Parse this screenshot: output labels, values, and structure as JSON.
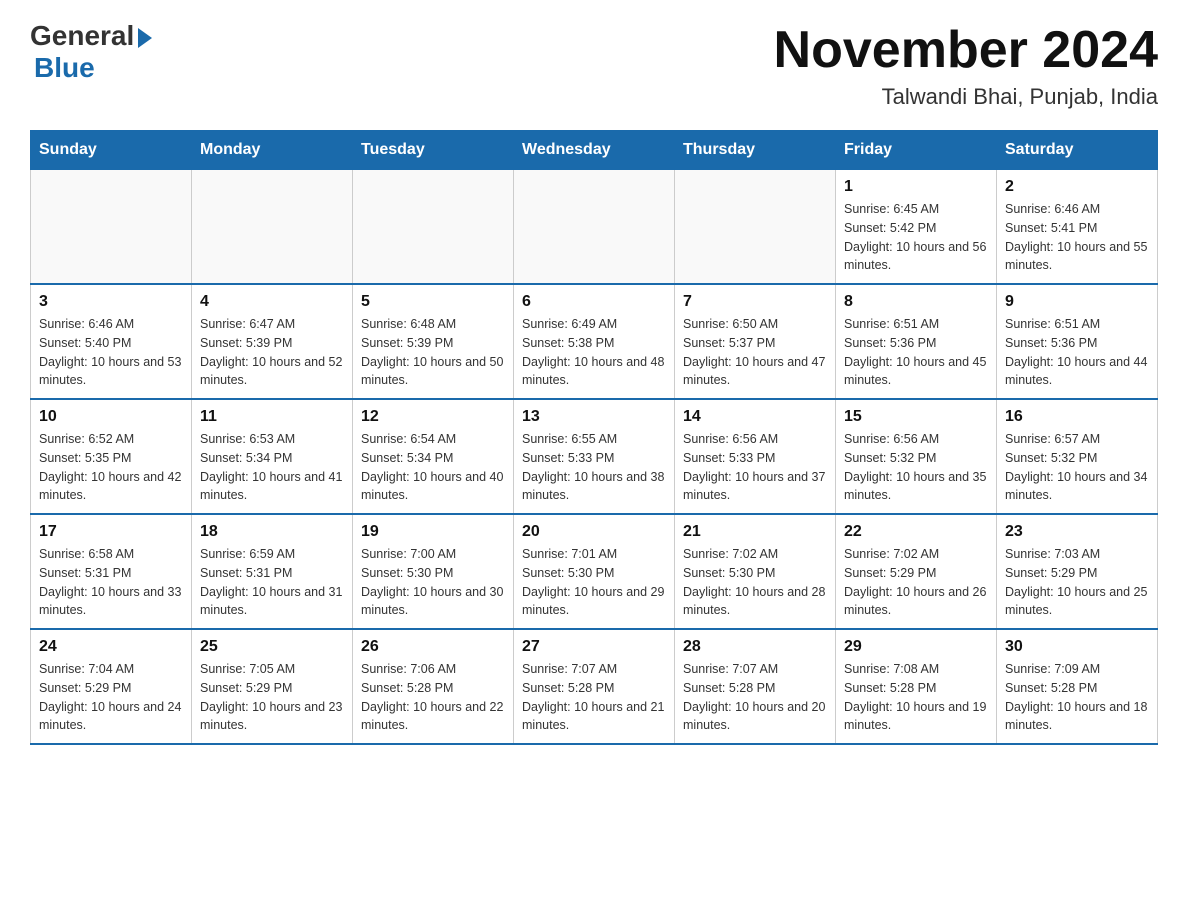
{
  "header": {
    "logo_general": "General",
    "logo_blue": "Blue",
    "month_year": "November 2024",
    "location": "Talwandi Bhai, Punjab, India"
  },
  "days_of_week": [
    "Sunday",
    "Monday",
    "Tuesday",
    "Wednesday",
    "Thursday",
    "Friday",
    "Saturday"
  ],
  "weeks": [
    [
      {
        "day": "",
        "sunrise": "",
        "sunset": "",
        "daylight": ""
      },
      {
        "day": "",
        "sunrise": "",
        "sunset": "",
        "daylight": ""
      },
      {
        "day": "",
        "sunrise": "",
        "sunset": "",
        "daylight": ""
      },
      {
        "day": "",
        "sunrise": "",
        "sunset": "",
        "daylight": ""
      },
      {
        "day": "",
        "sunrise": "",
        "sunset": "",
        "daylight": ""
      },
      {
        "day": "1",
        "sunrise": "Sunrise: 6:45 AM",
        "sunset": "Sunset: 5:42 PM",
        "daylight": "Daylight: 10 hours and 56 minutes."
      },
      {
        "day": "2",
        "sunrise": "Sunrise: 6:46 AM",
        "sunset": "Sunset: 5:41 PM",
        "daylight": "Daylight: 10 hours and 55 minutes."
      }
    ],
    [
      {
        "day": "3",
        "sunrise": "Sunrise: 6:46 AM",
        "sunset": "Sunset: 5:40 PM",
        "daylight": "Daylight: 10 hours and 53 minutes."
      },
      {
        "day": "4",
        "sunrise": "Sunrise: 6:47 AM",
        "sunset": "Sunset: 5:39 PM",
        "daylight": "Daylight: 10 hours and 52 minutes."
      },
      {
        "day": "5",
        "sunrise": "Sunrise: 6:48 AM",
        "sunset": "Sunset: 5:39 PM",
        "daylight": "Daylight: 10 hours and 50 minutes."
      },
      {
        "day": "6",
        "sunrise": "Sunrise: 6:49 AM",
        "sunset": "Sunset: 5:38 PM",
        "daylight": "Daylight: 10 hours and 48 minutes."
      },
      {
        "day": "7",
        "sunrise": "Sunrise: 6:50 AM",
        "sunset": "Sunset: 5:37 PM",
        "daylight": "Daylight: 10 hours and 47 minutes."
      },
      {
        "day": "8",
        "sunrise": "Sunrise: 6:51 AM",
        "sunset": "Sunset: 5:36 PM",
        "daylight": "Daylight: 10 hours and 45 minutes."
      },
      {
        "day": "9",
        "sunrise": "Sunrise: 6:51 AM",
        "sunset": "Sunset: 5:36 PM",
        "daylight": "Daylight: 10 hours and 44 minutes."
      }
    ],
    [
      {
        "day": "10",
        "sunrise": "Sunrise: 6:52 AM",
        "sunset": "Sunset: 5:35 PM",
        "daylight": "Daylight: 10 hours and 42 minutes."
      },
      {
        "day": "11",
        "sunrise": "Sunrise: 6:53 AM",
        "sunset": "Sunset: 5:34 PM",
        "daylight": "Daylight: 10 hours and 41 minutes."
      },
      {
        "day": "12",
        "sunrise": "Sunrise: 6:54 AM",
        "sunset": "Sunset: 5:34 PM",
        "daylight": "Daylight: 10 hours and 40 minutes."
      },
      {
        "day": "13",
        "sunrise": "Sunrise: 6:55 AM",
        "sunset": "Sunset: 5:33 PM",
        "daylight": "Daylight: 10 hours and 38 minutes."
      },
      {
        "day": "14",
        "sunrise": "Sunrise: 6:56 AM",
        "sunset": "Sunset: 5:33 PM",
        "daylight": "Daylight: 10 hours and 37 minutes."
      },
      {
        "day": "15",
        "sunrise": "Sunrise: 6:56 AM",
        "sunset": "Sunset: 5:32 PM",
        "daylight": "Daylight: 10 hours and 35 minutes."
      },
      {
        "day": "16",
        "sunrise": "Sunrise: 6:57 AM",
        "sunset": "Sunset: 5:32 PM",
        "daylight": "Daylight: 10 hours and 34 minutes."
      }
    ],
    [
      {
        "day": "17",
        "sunrise": "Sunrise: 6:58 AM",
        "sunset": "Sunset: 5:31 PM",
        "daylight": "Daylight: 10 hours and 33 minutes."
      },
      {
        "day": "18",
        "sunrise": "Sunrise: 6:59 AM",
        "sunset": "Sunset: 5:31 PM",
        "daylight": "Daylight: 10 hours and 31 minutes."
      },
      {
        "day": "19",
        "sunrise": "Sunrise: 7:00 AM",
        "sunset": "Sunset: 5:30 PM",
        "daylight": "Daylight: 10 hours and 30 minutes."
      },
      {
        "day": "20",
        "sunrise": "Sunrise: 7:01 AM",
        "sunset": "Sunset: 5:30 PM",
        "daylight": "Daylight: 10 hours and 29 minutes."
      },
      {
        "day": "21",
        "sunrise": "Sunrise: 7:02 AM",
        "sunset": "Sunset: 5:30 PM",
        "daylight": "Daylight: 10 hours and 28 minutes."
      },
      {
        "day": "22",
        "sunrise": "Sunrise: 7:02 AM",
        "sunset": "Sunset: 5:29 PM",
        "daylight": "Daylight: 10 hours and 26 minutes."
      },
      {
        "day": "23",
        "sunrise": "Sunrise: 7:03 AM",
        "sunset": "Sunset: 5:29 PM",
        "daylight": "Daylight: 10 hours and 25 minutes."
      }
    ],
    [
      {
        "day": "24",
        "sunrise": "Sunrise: 7:04 AM",
        "sunset": "Sunset: 5:29 PM",
        "daylight": "Daylight: 10 hours and 24 minutes."
      },
      {
        "day": "25",
        "sunrise": "Sunrise: 7:05 AM",
        "sunset": "Sunset: 5:29 PM",
        "daylight": "Daylight: 10 hours and 23 minutes."
      },
      {
        "day": "26",
        "sunrise": "Sunrise: 7:06 AM",
        "sunset": "Sunset: 5:28 PM",
        "daylight": "Daylight: 10 hours and 22 minutes."
      },
      {
        "day": "27",
        "sunrise": "Sunrise: 7:07 AM",
        "sunset": "Sunset: 5:28 PM",
        "daylight": "Daylight: 10 hours and 21 minutes."
      },
      {
        "day": "28",
        "sunrise": "Sunrise: 7:07 AM",
        "sunset": "Sunset: 5:28 PM",
        "daylight": "Daylight: 10 hours and 20 minutes."
      },
      {
        "day": "29",
        "sunrise": "Sunrise: 7:08 AM",
        "sunset": "Sunset: 5:28 PM",
        "daylight": "Daylight: 10 hours and 19 minutes."
      },
      {
        "day": "30",
        "sunrise": "Sunrise: 7:09 AM",
        "sunset": "Sunset: 5:28 PM",
        "daylight": "Daylight: 10 hours and 18 minutes."
      }
    ]
  ],
  "accent_color": "#1a6aab"
}
